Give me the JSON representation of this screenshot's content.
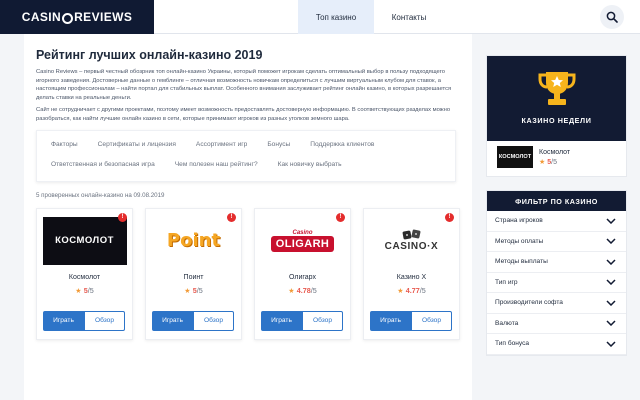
{
  "header": {
    "logo": {
      "left": "CASIN",
      "right": "REVIEWS"
    },
    "tabs": [
      {
        "label": "Топ казино",
        "active": true
      },
      {
        "label": "Контакты",
        "active": false
      }
    ],
    "search_icon": "search-icon"
  },
  "main": {
    "title": "Рейтинг лучших онлайн-казино 2019",
    "intro": [
      "Casino Reviews – первый честный обозрник топ онлайн-казино Украины, который поможет игрокам сделать оптимальный выбор в пользу подходящего игорного заведения. Достоверные данные о гемблинге – отличная возможность новичкам определиться с лучшим виртуальным клубом для ставок, а настоящим профессионалам – найти портал для стабильных выплат. Особенного внимания заслуживает рейтинг онлайн казино, в которых разрешается делать ставки на реальные деньги.",
      "Сайт не сотрудничает с другими проектами, поэтому имеет возможность предоставлять достоверную информацию. В соответствующих разделах можно разобраться, как найти лучшие онлайн казино в сети, которые принимают игроков из разных уголков земного шара."
    ],
    "toc": [
      "Факторы",
      "Сертификаты и лицензия",
      "Ассортимент игр",
      "Бонусы",
      "Поддержка клиентов",
      "Ответственная и безопасная игра",
      "Чем полезен наш рейтинг?",
      "Как новичку выбрать"
    ],
    "count_text": "5 проверенных онлайн-казино на 09.08.2019",
    "cards": [
      {
        "name": "Космолот",
        "logo": "КОСМОЛОТ",
        "rating": "5",
        "max": "/5",
        "play": "Играть",
        "review": "Обзор",
        "badge": "!"
      },
      {
        "name": "Поинт",
        "logo": "Point",
        "rating": "5",
        "max": "/5",
        "play": "Играть",
        "review": "Обзор",
        "badge": "!"
      },
      {
        "name": "Олигарх",
        "logo": "OLIGARH",
        "logo_sub": "Casino",
        "rating": "4.78",
        "max": "/5",
        "play": "Играть",
        "review": "Обзор",
        "badge": "!"
      },
      {
        "name": "Казино Х",
        "logo": "CASINO·X",
        "rating": "4.77",
        "max": "/5",
        "play": "Играть",
        "review": "Обзор",
        "badge": "!"
      }
    ]
  },
  "sidebar": {
    "week": {
      "title": "КАЗИНО НЕДЕЛИ",
      "icon": "trophy-icon",
      "item": {
        "name": "Космолот",
        "logo": "КОСМОЛОТ",
        "rating": "5",
        "max": "/5"
      }
    },
    "filter": {
      "title": "ФИЛЬТР ПО КАЗИНО",
      "rows": [
        "Страна игроков",
        "Методы оплаты",
        "Методы выплаты",
        "Тип игр",
        "Производители софта",
        "Валюта",
        "Тип бонуса"
      ]
    }
  },
  "colors": {
    "accent": "#2d74c8",
    "navy": "#121b33",
    "star": "#f29b38",
    "rating": "#e85a4f",
    "badge": "#e42d2d"
  }
}
